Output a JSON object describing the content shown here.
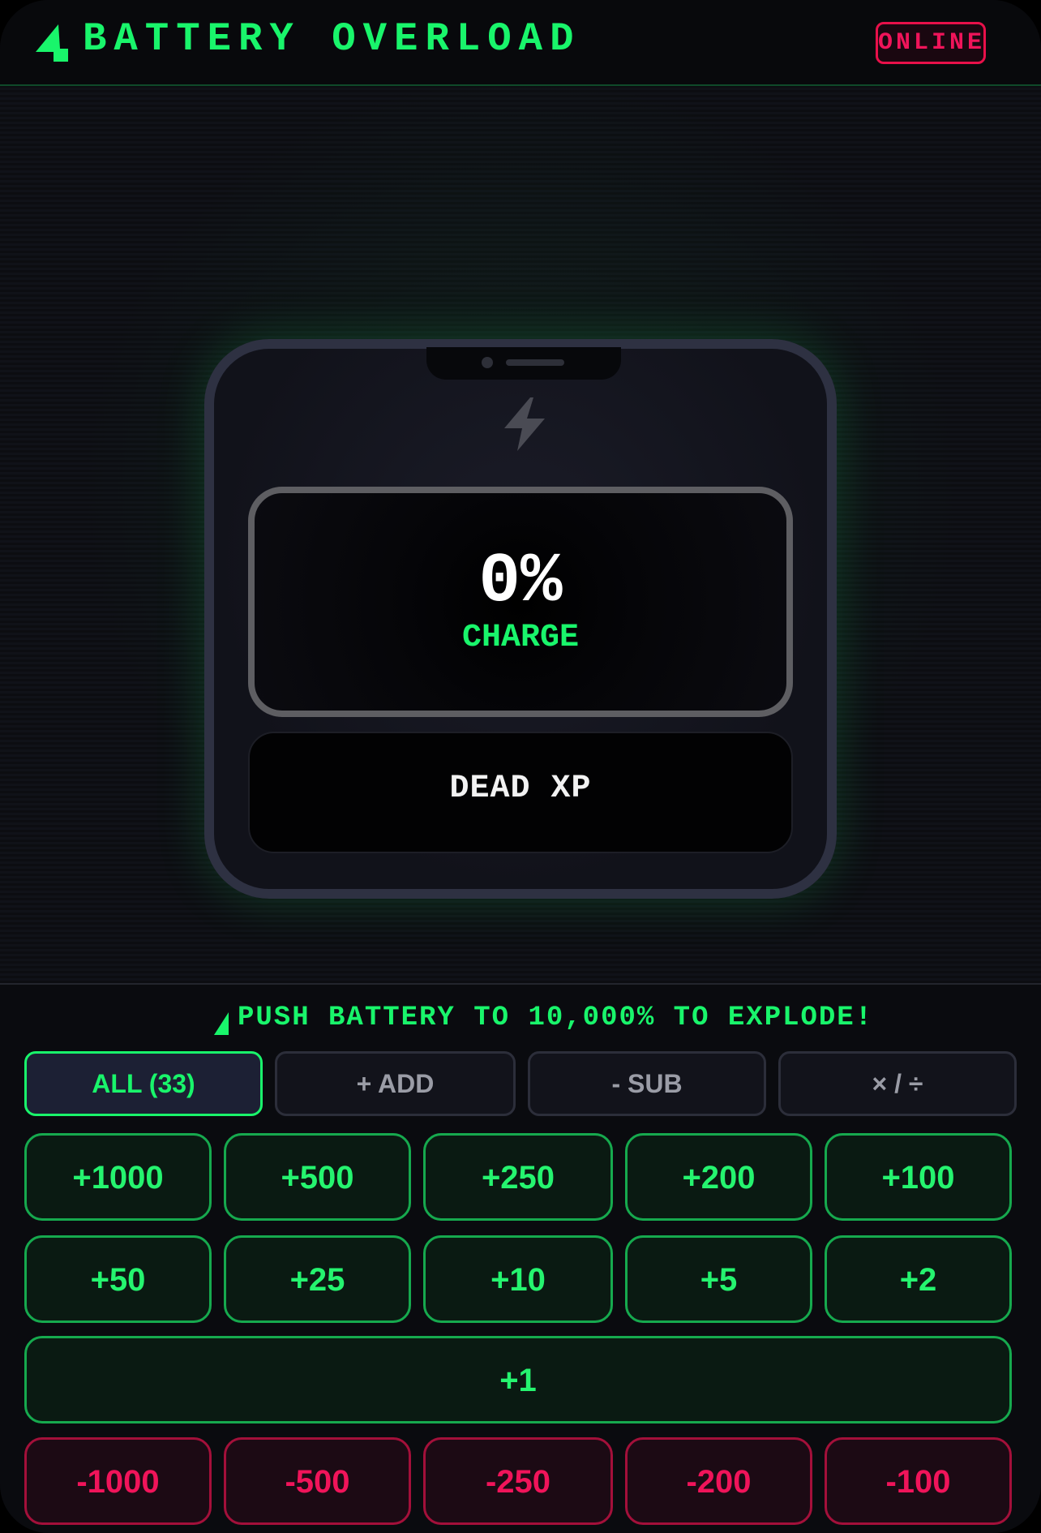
{
  "header": {
    "title": "BATTERY OVERLOAD",
    "status": "ONLINE",
    "accent_color": "#19f56b",
    "status_color": "#f0145a"
  },
  "device": {
    "icon": "lightning-bolt-icon",
    "charge_value": "0%",
    "charge_label": "CHARGE",
    "xp_label": "DEAD XP"
  },
  "controls": {
    "goal": "PUSH BATTERY TO 10,000% TO EXPLODE!",
    "tabs": [
      {
        "label": "ALL (33)",
        "active": true
      },
      {
        "label": "+ ADD",
        "active": false
      },
      {
        "label": "- SUB",
        "active": false
      },
      {
        "label": "× / ÷",
        "active": false
      }
    ],
    "add_buttons": [
      "+1000",
      "+500",
      "+250",
      "+200",
      "+100",
      "+50",
      "+25",
      "+10",
      "+5",
      "+2",
      "+1"
    ],
    "sub_buttons": [
      "-1000",
      "-500",
      "-250",
      "-200",
      "-100"
    ]
  }
}
